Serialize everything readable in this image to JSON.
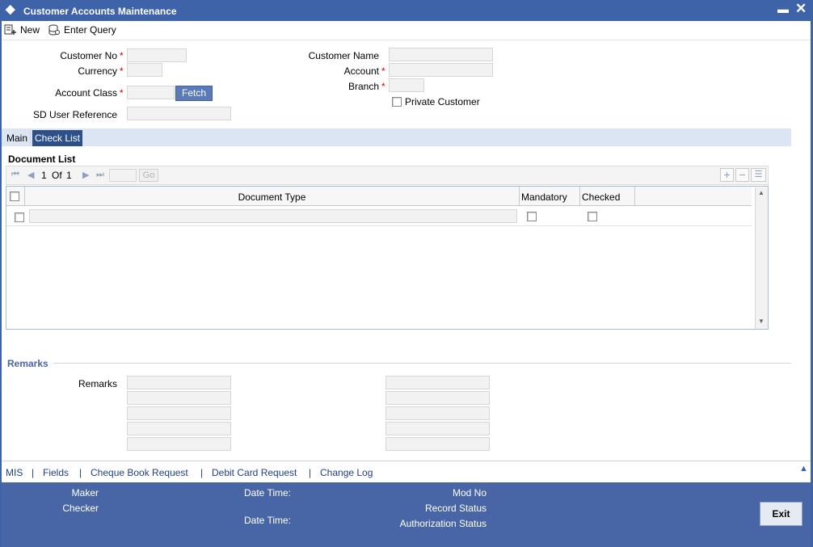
{
  "window": {
    "title": "Customer Accounts Maintenance",
    "minimize": "▬",
    "close": "✕"
  },
  "toolbar": {
    "new_label": "New",
    "enter_query_label": "Enter Query"
  },
  "form": {
    "customer_no_label": "Customer No",
    "currency_label": "Currency",
    "account_class_label": "Account Class",
    "fetch_label": "Fetch",
    "sd_user_reference_label": "SD User Reference",
    "customer_name_label": "Customer Name",
    "account_label": "Account",
    "branch_label": "Branch",
    "private_customer_label": "Private Customer",
    "required_marker": "*"
  },
  "tabs": [
    {
      "label": "Main"
    },
    {
      "label": "Check List"
    }
  ],
  "document_list": {
    "title": "Document List",
    "pagination": {
      "current": "1",
      "of_label": "Of",
      "total": "1",
      "go_label": "Go"
    },
    "columns": [
      "Document Type",
      "Mandatory",
      "Checked"
    ]
  },
  "remarks": {
    "section_title": "Remarks",
    "field_label": "Remarks"
  },
  "links": [
    "MIS",
    "Fields",
    "Cheque Book Request",
    "Debit Card Request",
    "Change Log"
  ],
  "link_separator": "|",
  "footer": {
    "maker_label": "Maker",
    "checker_label": "Checker",
    "date_time_label": "Date Time:",
    "mod_no_label": "Mod No",
    "record_status_label": "Record Status",
    "authorization_status_label": "Authorization Status",
    "exit_label": "Exit"
  },
  "colors": {
    "title_bar": "#3f63a8",
    "footer": "#4866a6",
    "active_tab": "#2d4f8c",
    "link": "#1e3f8a",
    "required": "#d40000"
  }
}
